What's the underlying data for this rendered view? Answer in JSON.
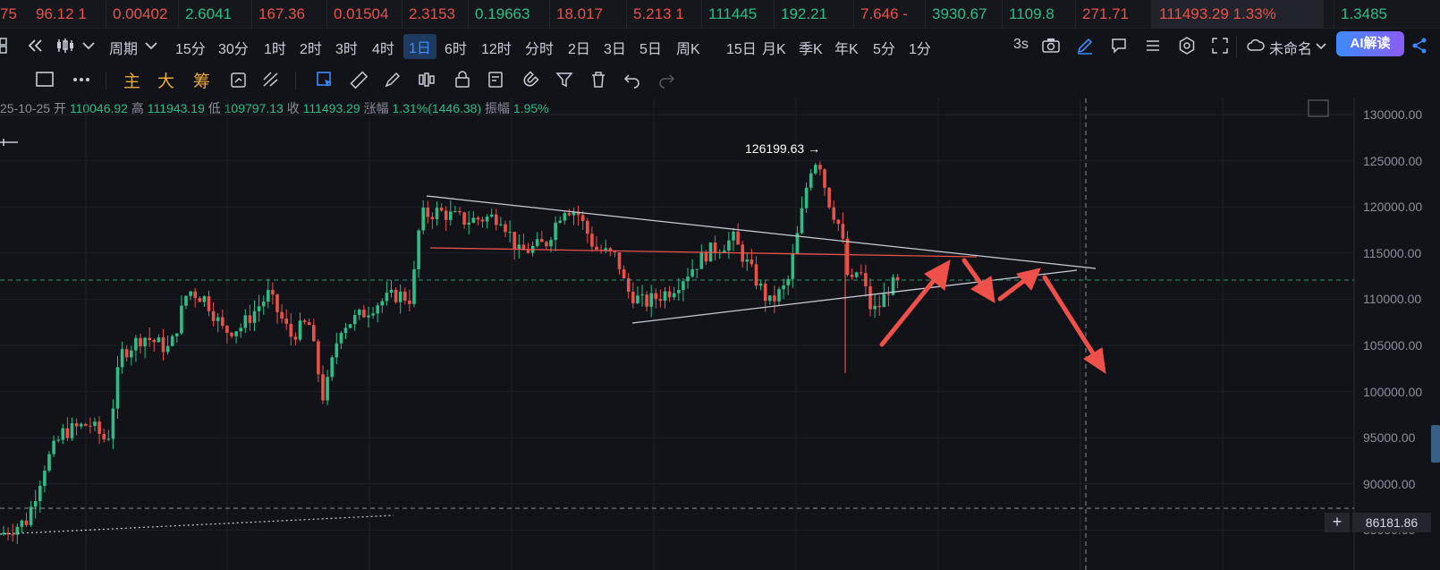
{
  "ticker": [
    {
      "text": "75",
      "dir": "down"
    },
    {
      "text": "96.12 1",
      "dir": "down"
    },
    {
      "text": "0.00402",
      "dir": "down"
    },
    {
      "text": "2.6041",
      "dir": "up"
    },
    {
      "text": "167.36",
      "dir": "down"
    },
    {
      "text": "0.01504",
      "dir": "down"
    },
    {
      "text": "2.3153",
      "dir": "down"
    },
    {
      "text": "0.19663",
      "dir": "up"
    },
    {
      "text": "18.017",
      "dir": "down"
    },
    {
      "text": "5.213 1",
      "dir": "down"
    },
    {
      "text": "111445",
      "dir": "up"
    },
    {
      "text": "192.21",
      "dir": "up"
    },
    {
      "text": "7.646 -",
      "dir": "down"
    },
    {
      "text": "3930.67",
      "dir": "up"
    },
    {
      "text": "1109.8",
      "dir": "up"
    },
    {
      "text": "271.71",
      "dir": "down"
    },
    {
      "text": "111493.29 1.33%",
      "dir": "down"
    },
    {
      "text": "1.3485",
      "dir": "up"
    }
  ],
  "toolbar": {
    "period_label": "周期",
    "intervals": [
      "15分",
      "30分",
      "1时",
      "2时",
      "3时",
      "4时",
      "1日",
      "6时",
      "12时",
      "分时",
      "2日",
      "3日",
      "5日",
      "周K",
      "15日",
      "月K",
      "季K",
      "年K",
      "5分",
      "1分"
    ],
    "active_interval": "1日",
    "refresh": "3s",
    "layout_name": "未命名",
    "ai_label": "AI解读"
  },
  "draw_tools": {
    "main": "主",
    "large": "大",
    "chips": "筹"
  },
  "ohlc": {
    "date": "25-10-25",
    "open_label": "开",
    "open": "110046.92",
    "high_label": "高",
    "high": "111943.19",
    "low_label": "低",
    "low": "109797.13",
    "close_label": "收",
    "close": "111493.29",
    "change_label": "涨幅",
    "change": "1.31%(1446.38)",
    "amp_label": "振幅",
    "amp": "1.95%"
  },
  "axis": {
    "labels": [
      "130000.00",
      "125000.00",
      "120000.00",
      "115000.00",
      "110000.00",
      "105000.00",
      "100000.00",
      "95000.00",
      "90000.00",
      "85000.00"
    ]
  },
  "crosshair_price": "86181.86",
  "high_marker": "126199.63 →",
  "colors": {
    "up": "#2ebd85",
    "down": "#e9524a",
    "background": "#121319",
    "annotation": "#f0504a",
    "accent": "#3d8bfd"
  }
}
